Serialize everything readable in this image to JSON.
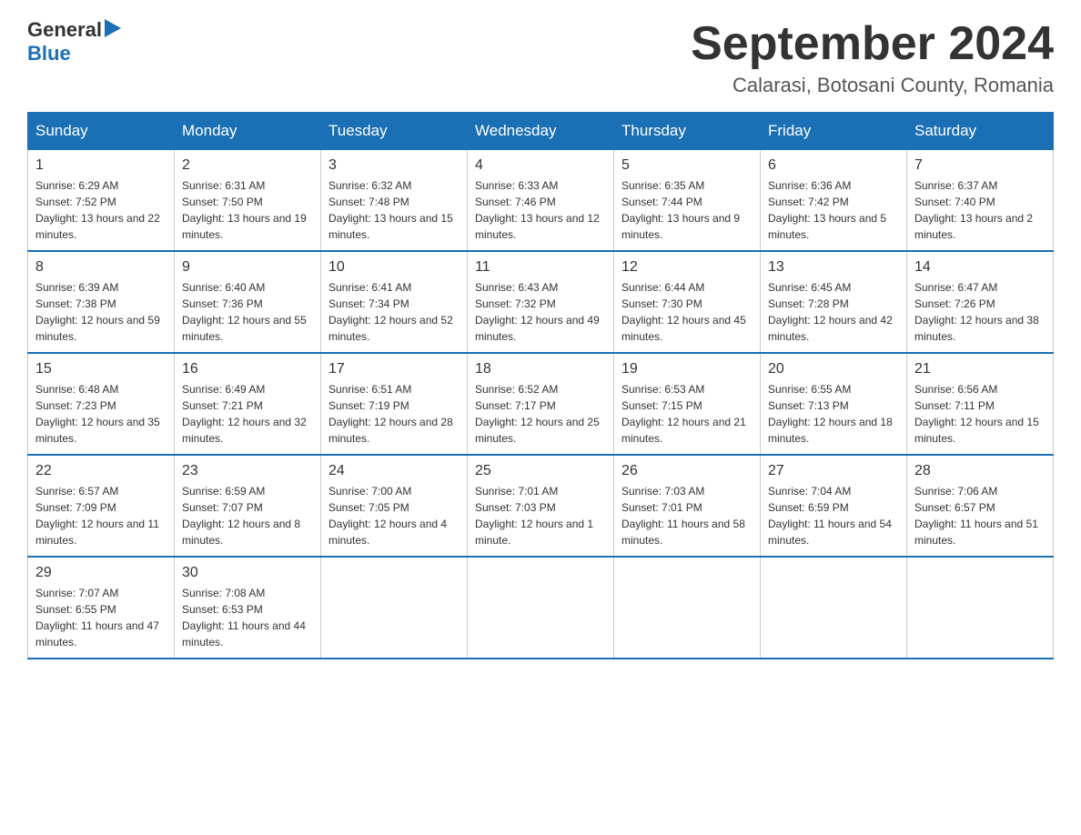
{
  "header": {
    "logo": {
      "general": "General",
      "blue": "Blue"
    },
    "title": "September 2024",
    "subtitle": "Calarasi, Botosani County, Romania"
  },
  "calendar": {
    "days_of_week": [
      "Sunday",
      "Monday",
      "Tuesday",
      "Wednesday",
      "Thursday",
      "Friday",
      "Saturday"
    ],
    "weeks": [
      [
        {
          "date": "1",
          "sunrise": "6:29 AM",
          "sunset": "7:52 PM",
          "daylight": "13 hours and 22 minutes."
        },
        {
          "date": "2",
          "sunrise": "6:31 AM",
          "sunset": "7:50 PM",
          "daylight": "13 hours and 19 minutes."
        },
        {
          "date": "3",
          "sunrise": "6:32 AM",
          "sunset": "7:48 PM",
          "daylight": "13 hours and 15 minutes."
        },
        {
          "date": "4",
          "sunrise": "6:33 AM",
          "sunset": "7:46 PM",
          "daylight": "13 hours and 12 minutes."
        },
        {
          "date": "5",
          "sunrise": "6:35 AM",
          "sunset": "7:44 PM",
          "daylight": "13 hours and 9 minutes."
        },
        {
          "date": "6",
          "sunrise": "6:36 AM",
          "sunset": "7:42 PM",
          "daylight": "13 hours and 5 minutes."
        },
        {
          "date": "7",
          "sunrise": "6:37 AM",
          "sunset": "7:40 PM",
          "daylight": "13 hours and 2 minutes."
        }
      ],
      [
        {
          "date": "8",
          "sunrise": "6:39 AM",
          "sunset": "7:38 PM",
          "daylight": "12 hours and 59 minutes."
        },
        {
          "date": "9",
          "sunrise": "6:40 AM",
          "sunset": "7:36 PM",
          "daylight": "12 hours and 55 minutes."
        },
        {
          "date": "10",
          "sunrise": "6:41 AM",
          "sunset": "7:34 PM",
          "daylight": "12 hours and 52 minutes."
        },
        {
          "date": "11",
          "sunrise": "6:43 AM",
          "sunset": "7:32 PM",
          "daylight": "12 hours and 49 minutes."
        },
        {
          "date": "12",
          "sunrise": "6:44 AM",
          "sunset": "7:30 PM",
          "daylight": "12 hours and 45 minutes."
        },
        {
          "date": "13",
          "sunrise": "6:45 AM",
          "sunset": "7:28 PM",
          "daylight": "12 hours and 42 minutes."
        },
        {
          "date": "14",
          "sunrise": "6:47 AM",
          "sunset": "7:26 PM",
          "daylight": "12 hours and 38 minutes."
        }
      ],
      [
        {
          "date": "15",
          "sunrise": "6:48 AM",
          "sunset": "7:23 PM",
          "daylight": "12 hours and 35 minutes."
        },
        {
          "date": "16",
          "sunrise": "6:49 AM",
          "sunset": "7:21 PM",
          "daylight": "12 hours and 32 minutes."
        },
        {
          "date": "17",
          "sunrise": "6:51 AM",
          "sunset": "7:19 PM",
          "daylight": "12 hours and 28 minutes."
        },
        {
          "date": "18",
          "sunrise": "6:52 AM",
          "sunset": "7:17 PM",
          "daylight": "12 hours and 25 minutes."
        },
        {
          "date": "19",
          "sunrise": "6:53 AM",
          "sunset": "7:15 PM",
          "daylight": "12 hours and 21 minutes."
        },
        {
          "date": "20",
          "sunrise": "6:55 AM",
          "sunset": "7:13 PM",
          "daylight": "12 hours and 18 minutes."
        },
        {
          "date": "21",
          "sunrise": "6:56 AM",
          "sunset": "7:11 PM",
          "daylight": "12 hours and 15 minutes."
        }
      ],
      [
        {
          "date": "22",
          "sunrise": "6:57 AM",
          "sunset": "7:09 PM",
          "daylight": "12 hours and 11 minutes."
        },
        {
          "date": "23",
          "sunrise": "6:59 AM",
          "sunset": "7:07 PM",
          "daylight": "12 hours and 8 minutes."
        },
        {
          "date": "24",
          "sunrise": "7:00 AM",
          "sunset": "7:05 PM",
          "daylight": "12 hours and 4 minutes."
        },
        {
          "date": "25",
          "sunrise": "7:01 AM",
          "sunset": "7:03 PM",
          "daylight": "12 hours and 1 minute."
        },
        {
          "date": "26",
          "sunrise": "7:03 AM",
          "sunset": "7:01 PM",
          "daylight": "11 hours and 58 minutes."
        },
        {
          "date": "27",
          "sunrise": "7:04 AM",
          "sunset": "6:59 PM",
          "daylight": "11 hours and 54 minutes."
        },
        {
          "date": "28",
          "sunrise": "7:06 AM",
          "sunset": "6:57 PM",
          "daylight": "11 hours and 51 minutes."
        }
      ],
      [
        {
          "date": "29",
          "sunrise": "7:07 AM",
          "sunset": "6:55 PM",
          "daylight": "11 hours and 47 minutes."
        },
        {
          "date": "30",
          "sunrise": "7:08 AM",
          "sunset": "6:53 PM",
          "daylight": "11 hours and 44 minutes."
        },
        null,
        null,
        null,
        null,
        null
      ]
    ],
    "labels": {
      "sunrise": "Sunrise:",
      "sunset": "Sunset:",
      "daylight": "Daylight:"
    }
  }
}
